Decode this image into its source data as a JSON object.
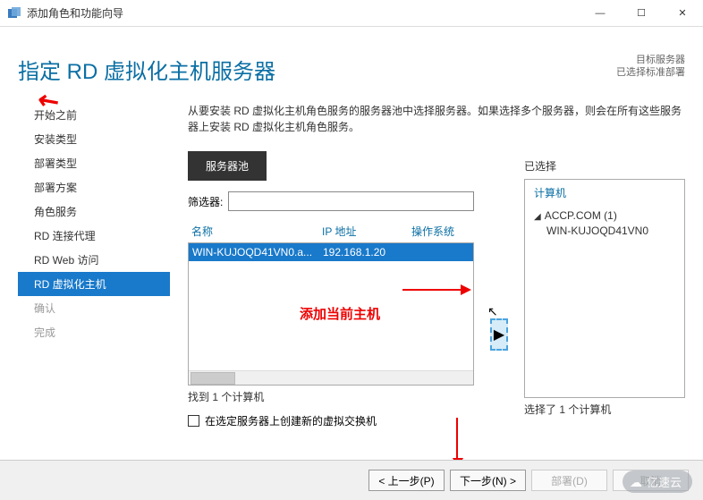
{
  "window": {
    "title": "添加角色和功能向导",
    "minimize": "—",
    "maximize": "☐",
    "close": "✕"
  },
  "header": {
    "page_title": "指定 RD 虚拟化主机服务器",
    "target_label": "目标服务器",
    "target_value": "已选择标准部署"
  },
  "sidebar": {
    "items": [
      {
        "label": "开始之前",
        "state": "done"
      },
      {
        "label": "安装类型",
        "state": "done"
      },
      {
        "label": "部署类型",
        "state": "done"
      },
      {
        "label": "部署方案",
        "state": "done"
      },
      {
        "label": "角色服务",
        "state": "done"
      },
      {
        "label": "RD 连接代理",
        "state": "done"
      },
      {
        "label": "RD Web 访问",
        "state": "done"
      },
      {
        "label": "RD 虚拟化主机",
        "state": "active"
      },
      {
        "label": "确认",
        "state": "pending"
      },
      {
        "label": "完成",
        "state": "pending"
      }
    ]
  },
  "main": {
    "description": "从要安装 RD 虚拟化主机角色服务的服务器池中选择服务器。如果选择多个服务器，则会在所有这些服务器上安装 RD 虚拟化主机角色服务。",
    "tab_label": "服务器池",
    "filter_label": "筛选器:",
    "filter_value": "",
    "columns": {
      "name": "名称",
      "ip": "IP 地址",
      "os": "操作系统"
    },
    "rows": [
      {
        "name": "WIN-KUJOQD41VN0.a...",
        "ip": "192.168.1.20",
        "os": ""
      }
    ],
    "found_text": "找到 1 个计算机",
    "checkbox_label": "在选定服务器上创建新的虚拟交换机",
    "add_arrow": "▶"
  },
  "right": {
    "title": "已选择",
    "computer_header": "计算机",
    "domain": "ACCP.COM (1)",
    "server": "WIN-KUJOQD41VN0",
    "selected_text": "选择了 1 个计算机"
  },
  "annotation": {
    "text": "添加当前主机"
  },
  "footer": {
    "prev": "< 上一步(P)",
    "next": "下一步(N) >",
    "deploy": "部署(D)",
    "cancel": "取消"
  },
  "watermark": "亿速云"
}
